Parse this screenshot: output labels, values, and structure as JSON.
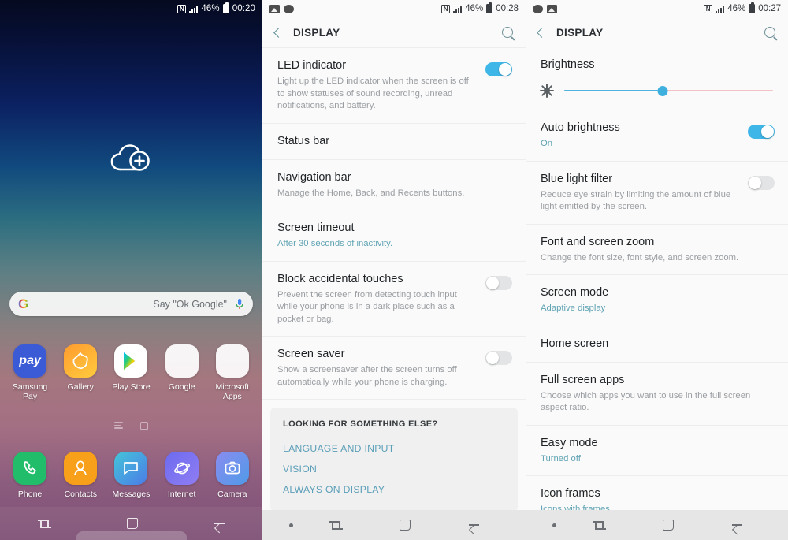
{
  "home_screen": {
    "status_bar": {
      "nfc_icon": "nfc-icon",
      "signal_icon": "signal-bars-icon",
      "battery_percent": "46%",
      "battery_icon": "battery-icon",
      "clock": "00:20"
    },
    "widget": {
      "name": "add-cloud-widget",
      "icon": "cloud-plus-icon"
    },
    "search": {
      "logo": "google-g-logo",
      "placeholder": "Say \"Ok Google\"",
      "mic_icon": "microphone-icon"
    },
    "apps_row1": [
      {
        "label": "Samsung\nPay",
        "label_line1": "Samsung",
        "label_line2": "Pay",
        "icon": "samsung-pay-icon",
        "glyph": "pay"
      },
      {
        "label": "Gallery",
        "icon": "gallery-icon",
        "glyph": ""
      },
      {
        "label": "Play Store",
        "icon": "play-store-icon",
        "glyph": ""
      },
      {
        "label": "Google",
        "icon": "google-folder-icon",
        "glyph": ""
      },
      {
        "label": "Microsoft\nApps",
        "label_line1": "Microsoft",
        "label_line2": "Apps",
        "icon": "microsoft-apps-folder-icon",
        "glyph": ""
      }
    ],
    "apps_row2": [
      {
        "label": "Phone",
        "icon": "phone-icon"
      },
      {
        "label": "Contacts",
        "icon": "contacts-icon"
      },
      {
        "label": "Messages",
        "icon": "messages-icon"
      },
      {
        "label": "Internet",
        "icon": "internet-icon"
      },
      {
        "label": "Camera",
        "icon": "camera-icon"
      }
    ],
    "page_indicators": [
      "apps-page-icon",
      "home-page-icon"
    ],
    "nav_bar": [
      "recents-icon",
      "home-icon",
      "back-icon"
    ]
  },
  "display_panel_1": {
    "status_bar": {
      "left_icons": [
        "screenshot-icon",
        "capsule-icon"
      ],
      "nfc_icon": "nfc-icon",
      "signal_icon": "signal-bars-icon",
      "battery_percent": "46%",
      "clock": "00:28"
    },
    "app_bar": {
      "back_icon": "back-chevron-icon",
      "title": "DISPLAY",
      "search_icon": "search-icon"
    },
    "rows": [
      {
        "title": "LED indicator",
        "subtitle": "Light up the LED indicator when the screen is off to show statuses of sound recording, unread notifications, and battery.",
        "subtitle_style": "grey",
        "control": "toggle",
        "toggle_state": "on"
      },
      {
        "title": "Status bar",
        "subtitle": "",
        "subtitle_style": "grey",
        "control": "none"
      },
      {
        "title": "Navigation bar",
        "subtitle": "Manage the Home, Back, and Recents buttons.",
        "subtitle_style": "grey",
        "control": "none"
      },
      {
        "title": "Screen timeout",
        "subtitle": "After 30 seconds of inactivity.",
        "subtitle_style": "teal",
        "control": "none"
      },
      {
        "title": "Block accidental touches",
        "subtitle": "Prevent the screen from detecting touch input while your phone is in a dark place such as a pocket or bag.",
        "subtitle_style": "grey",
        "control": "toggle",
        "toggle_state": "off"
      },
      {
        "title": "Screen saver",
        "subtitle": "Show a screensaver after the screen turns off automatically while your phone is charging.",
        "subtitle_style": "grey",
        "control": "toggle",
        "toggle_state": "off"
      }
    ],
    "looking_card": {
      "heading": "LOOKING FOR SOMETHING ELSE?",
      "links": [
        "LANGUAGE AND INPUT",
        "VISION",
        "ALWAYS ON DISPLAY"
      ]
    },
    "nav_bar": [
      "dot-icon",
      "recents-icon",
      "home-icon",
      "back-icon"
    ]
  },
  "display_panel_2": {
    "status_bar": {
      "left_icons": [
        "capsule-icon",
        "screenshot-icon"
      ],
      "nfc_icon": "nfc-icon",
      "signal_icon": "signal-bars-icon",
      "battery_percent": "46%",
      "clock": "00:27"
    },
    "app_bar": {
      "back_icon": "back-chevron-icon",
      "title": "DISPLAY",
      "search_icon": "search-icon"
    },
    "brightness": {
      "title": "Brightness",
      "icon": "brightness-sun-icon",
      "value_percent": 47
    },
    "rows": [
      {
        "title": "Auto brightness",
        "subtitle": "On",
        "subtitle_style": "teal",
        "control": "toggle",
        "toggle_state": "on"
      },
      {
        "title": "Blue light filter",
        "subtitle": "Reduce eye strain by limiting the amount of blue light emitted by the screen.",
        "subtitle_style": "grey",
        "control": "toggle",
        "toggle_state": "off"
      },
      {
        "title": "Font and screen zoom",
        "subtitle": "Change the font size, font style, and screen zoom.",
        "subtitle_style": "grey",
        "control": "none"
      },
      {
        "title": "Screen mode",
        "subtitle": "Adaptive display",
        "subtitle_style": "teal",
        "control": "none"
      },
      {
        "title": "Home screen",
        "subtitle": "",
        "subtitle_style": "grey",
        "control": "none"
      },
      {
        "title": "Full screen apps",
        "subtitle": "Choose which apps you want to use in the full screen aspect ratio.",
        "subtitle_style": "grey",
        "control": "none"
      },
      {
        "title": "Easy mode",
        "subtitle": "Turned off",
        "subtitle_style": "teal",
        "control": "none"
      },
      {
        "title": "Icon frames",
        "subtitle": "Icons with frames",
        "subtitle_style": "teal",
        "control": "none"
      }
    ],
    "nav_bar": [
      "dot-icon",
      "recents-icon",
      "home-icon",
      "back-icon"
    ]
  },
  "colors": {
    "accent_toggle_on": "#3fb6e8",
    "accent_teal_text": "#5fa3b3",
    "slider_fill": "#4fb3e0",
    "slider_track": "#f2c3c6",
    "panel_bg": "#fafafa",
    "nav_bar_bg": "#e6e6e6"
  }
}
